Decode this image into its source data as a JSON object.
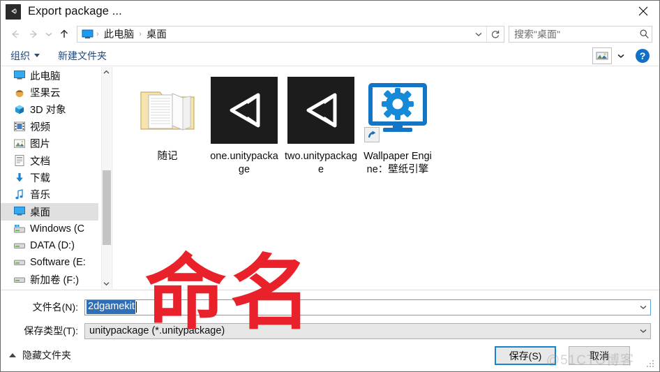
{
  "window": {
    "title": "Export package ...",
    "icon": "unity-icon",
    "close_label": "×"
  },
  "nav": {
    "back_icon": "arrow-left-icon",
    "forward_icon": "arrow-right-icon",
    "recent_icon": "chevron-down-icon",
    "up_icon": "arrow-up-icon",
    "address": {
      "root_icon": "this-pc-icon",
      "crumbs": [
        "此电脑",
        "桌面"
      ],
      "separator": "›",
      "dropdown_icon": "chevron-down-icon",
      "refresh_icon": "refresh-icon"
    },
    "search": {
      "placeholder": "搜索\"桌面\"",
      "value": "",
      "icon": "search-icon"
    }
  },
  "toolbar": {
    "organize_label": "组织",
    "organize_caret": "caret-down-icon",
    "new_folder_label": "新建文件夹",
    "view_icon": "view-mode-icon",
    "view_caret_icon": "chevron-down-icon",
    "help_label": "?",
    "help_icon": "help-icon"
  },
  "sidebar": {
    "items": [
      {
        "label": "此电脑",
        "icon": "this-pc-icon",
        "selected": false
      },
      {
        "label": "坚果云",
        "icon": "nutstore-icon",
        "selected": false
      },
      {
        "label": "3D 对象",
        "icon": "3d-objects-icon",
        "selected": false
      },
      {
        "label": "视频",
        "icon": "videos-icon",
        "selected": false
      },
      {
        "label": "图片",
        "icon": "pictures-icon",
        "selected": false
      },
      {
        "label": "文档",
        "icon": "documents-icon",
        "selected": false
      },
      {
        "label": "下载",
        "icon": "downloads-icon",
        "selected": false
      },
      {
        "label": "音乐",
        "icon": "music-icon",
        "selected": false
      },
      {
        "label": "桌面",
        "icon": "desktop-icon",
        "selected": true
      },
      {
        "label": "Windows (C",
        "icon": "windows-drive-icon",
        "selected": false
      },
      {
        "label": "DATA (D:)",
        "icon": "drive-icon",
        "selected": false
      },
      {
        "label": "Software (E:",
        "icon": "drive-icon",
        "selected": false
      },
      {
        "label": "新加卷 (F:)",
        "icon": "drive-icon",
        "selected": false
      }
    ],
    "scroll_up_icon": "chevron-up-icon",
    "scroll_down_icon": "chevron-down-icon"
  },
  "files": [
    {
      "label": "随记",
      "icon": "folder-icon",
      "shortcut": false
    },
    {
      "label": "one.unitypackage",
      "icon": "unity-package-icon",
      "shortcut": false
    },
    {
      "label": "two.unitypackage",
      "icon": "unity-package-icon",
      "shortcut": false
    },
    {
      "label": "Wallpaper Engine：壁纸引擎",
      "icon": "wallpaper-engine-icon",
      "shortcut": true
    }
  ],
  "form": {
    "filename_label": "文件名(N):",
    "filename_value": "2dgamekit",
    "filetype_label": "保存类型(T):",
    "filetype_value": "unitypackage (*.unitypackage)",
    "dropdown_icon": "chevron-down-icon"
  },
  "footer": {
    "hide_folders_label": "隐藏文件夹",
    "hide_folders_icon": "caret-up-icon",
    "save_label": "保存(S)",
    "cancel_label": "取消",
    "watermark": "@51CTO博客"
  },
  "annotation": {
    "text": "命名",
    "color": "#e8212a"
  }
}
